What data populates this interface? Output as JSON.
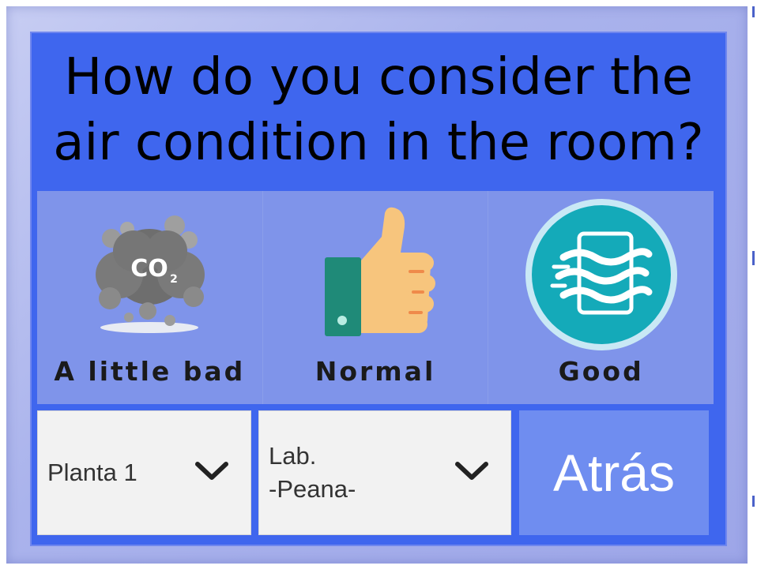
{
  "survey": {
    "question": "How do you consider the air condition in the room?",
    "options": [
      {
        "label": "A little bad",
        "icon": "co2-cloud-icon"
      },
      {
        "label": "Normal",
        "icon": "thumbs-up-icon"
      },
      {
        "label": "Good",
        "icon": "fresh-air-icon"
      }
    ]
  },
  "selectors": {
    "floor": {
      "value": "Planta 1",
      "icon": "chevron-down-icon"
    },
    "room": {
      "value": "Lab.\n-Peana-",
      "icon": "chevron-down-icon"
    }
  },
  "back_button": {
    "label": "Atrás"
  },
  "colors": {
    "panel": "#3f66ee",
    "options_bg": "#7f94ea",
    "back_button": "#6f8df0",
    "select_bg": "#f2f2f2",
    "frame": "#aab3ec"
  }
}
